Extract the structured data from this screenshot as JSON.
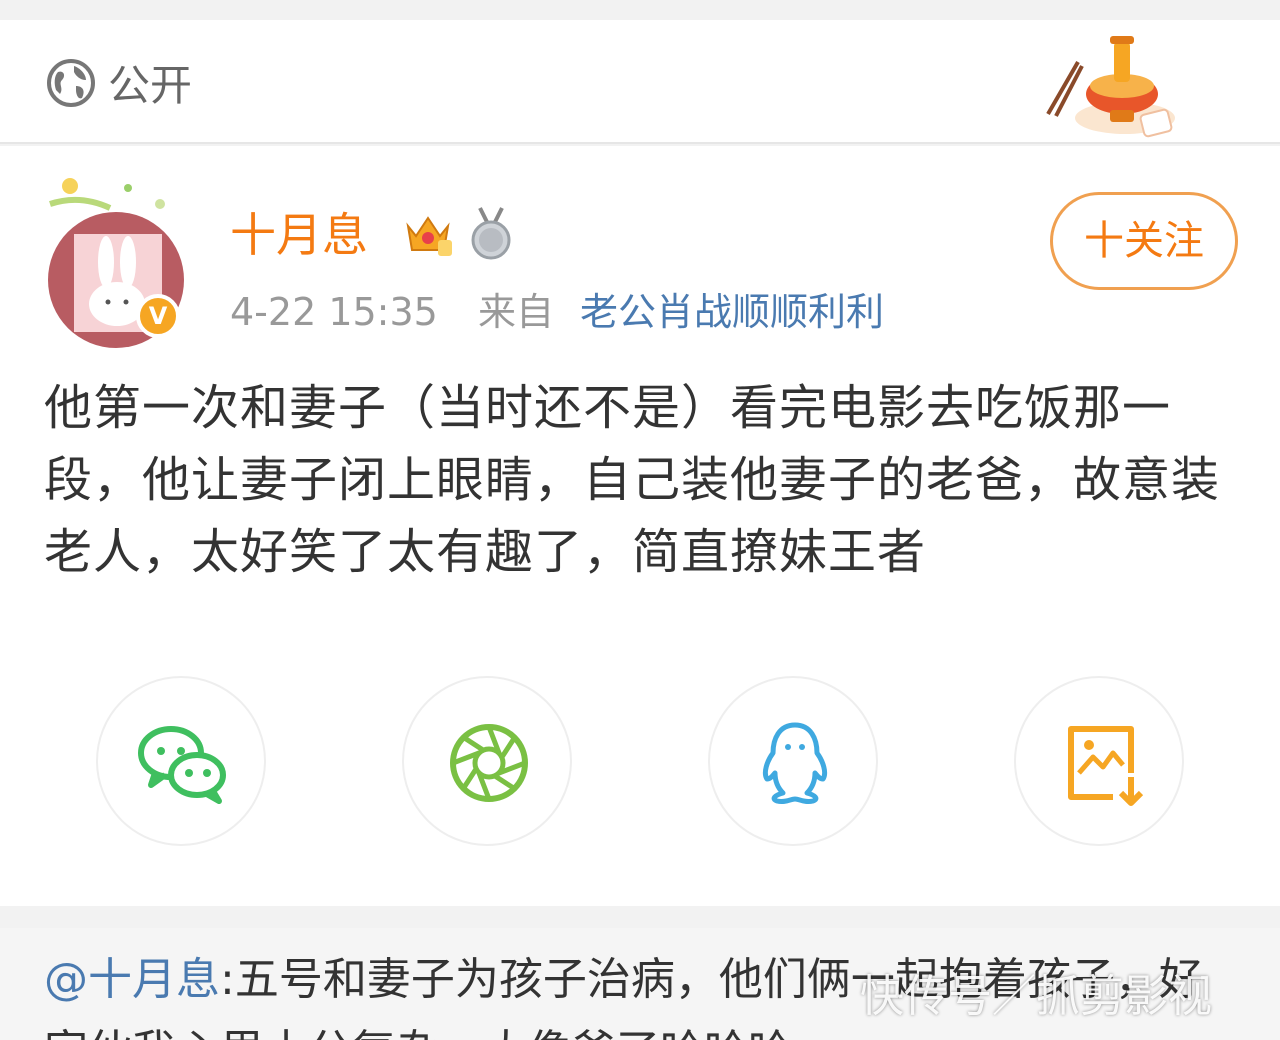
{
  "visibility": {
    "label": "公开",
    "icon": "globe-icon"
  },
  "decoration": {
    "icon": "hotpot-sticker-icon"
  },
  "post": {
    "author": "十月息",
    "badges": [
      "crown-vip-icon",
      "silver-medal-icon"
    ],
    "verified_mark": "V",
    "time": "4-22 15:35",
    "from_label": "来自",
    "source": "老公肖战顺顺利利",
    "follow_label": "十关注",
    "text": "他第一次和妻子（当时还不是）看完电影去吃饭那一段，他让妻子闭上眼睛，自己装他妻子的老爸，故意装老人，太好笑了太有趣了，简直撩妹王者"
  },
  "share": [
    {
      "name": "wechat",
      "icon": "wechat-icon",
      "color": "#3fbf5f"
    },
    {
      "name": "moments",
      "icon": "camera-aperture-icon",
      "color": "#7ac043"
    },
    {
      "name": "qq",
      "icon": "qq-penguin-icon",
      "color": "#3fa9e0"
    },
    {
      "name": "save-image",
      "icon": "save-image-icon",
      "color": "#f6a623"
    }
  ],
  "repost": {
    "mention": "@十月息",
    "text": ":五号和妻子为孩子治病，他们俩一起抱着孩子，好家伙我心里十分复杂，太像爸了哈哈哈"
  },
  "watermark": "快传号／抓剪影视"
}
